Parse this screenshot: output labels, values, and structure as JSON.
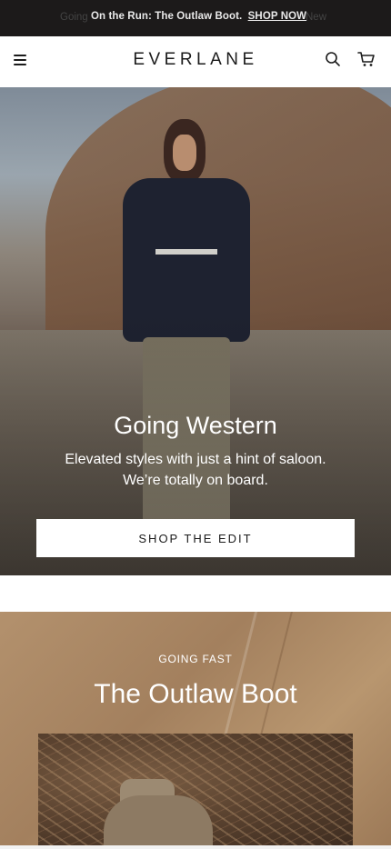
{
  "announcement": {
    "ghost_left": "Going",
    "message": "On the Run: The Outlaw Boot.",
    "link": "SHOP NOW",
    "ghost_right": "New"
  },
  "header": {
    "logo": "EVERLANE",
    "icons": [
      "menu-icon",
      "search-icon",
      "cart-icon"
    ]
  },
  "hero": {
    "title": "Going Western",
    "subtitle_line1": "Elevated styles with just a hint of saloon.",
    "subtitle_line2": "We’re totally on board.",
    "cta": "SHOP THE EDIT"
  },
  "feature": {
    "eyebrow": "GOING FAST",
    "title": "The Outlaw Boot"
  },
  "colors": {
    "announcement_bg": "#1c1a1a",
    "text_dark": "#1b1b1b",
    "cta_bg": "#ffffff"
  }
}
